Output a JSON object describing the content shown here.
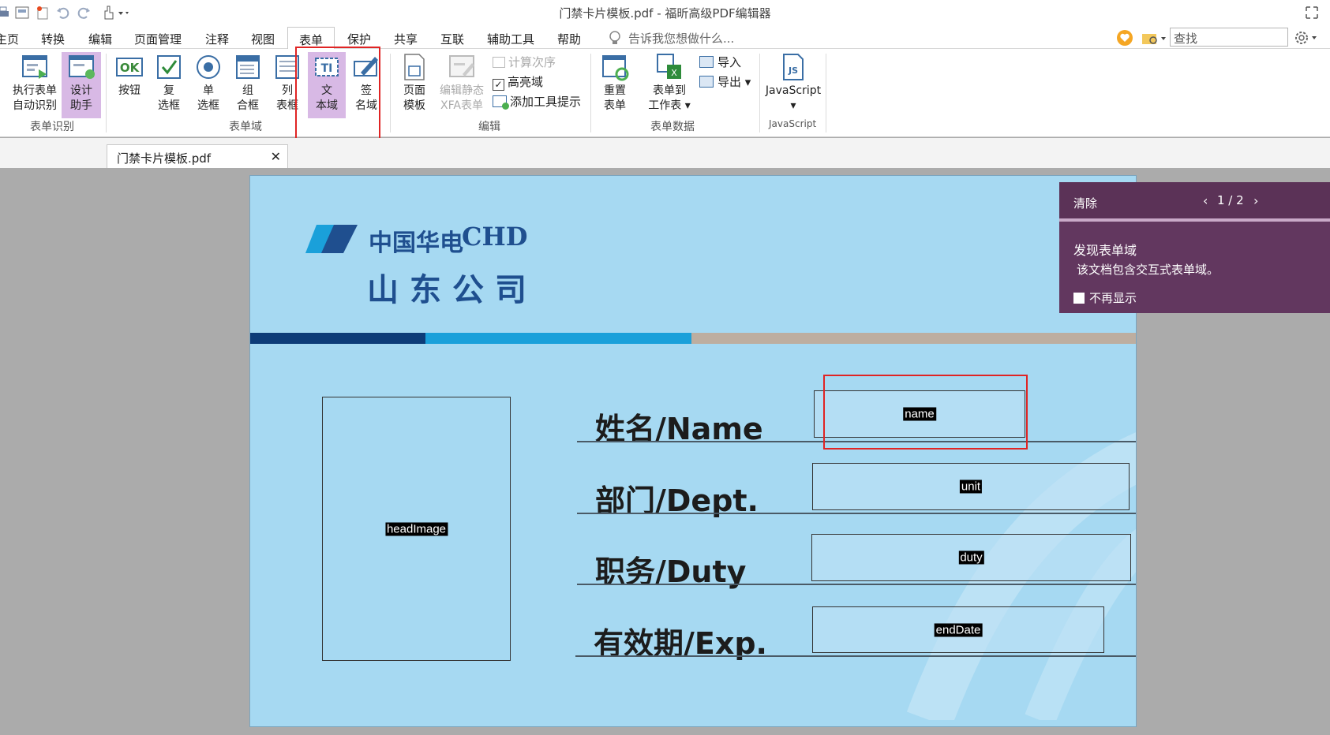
{
  "window": {
    "title": "门禁卡片模板.pdf - 福昕高级PDF编辑器"
  },
  "menu": {
    "items": [
      "主页",
      "转换",
      "编辑",
      "页面管理",
      "注释",
      "视图",
      "表单",
      "保护",
      "共享",
      "互联",
      "辅助工具",
      "帮助"
    ],
    "active": "表单",
    "tell_me": "告诉我您想做什么...",
    "search_placeholder": "查找"
  },
  "ribbon": {
    "groups": {
      "form_recognition": {
        "label": "表单识别",
        "run_recognition": [
          "执行表单",
          "自动识别"
        ],
        "design_assistant": [
          "设计",
          "助手"
        ]
      },
      "form_fields": {
        "label": "表单域",
        "push_button": "按钮",
        "checkbox": [
          "复",
          "选框"
        ],
        "radio": [
          "单",
          "选框"
        ],
        "combo": [
          "组",
          "合框"
        ],
        "list": [
          "列",
          "表框"
        ],
        "text_field": [
          "文",
          "本域"
        ],
        "signature": [
          "签",
          "名域"
        ]
      },
      "edit": {
        "label": "编辑",
        "page_templates": [
          "页面",
          "模板"
        ],
        "edit_static_xfa": [
          "编辑静态",
          "XFA表单"
        ],
        "calc_order": "计算次序",
        "highlight_fields": "高亮域",
        "add_tooltip": "添加工具提示"
      },
      "form_data": {
        "label": "表单数据",
        "reset": [
          "重置",
          "表单"
        ],
        "to_sheet": [
          "表单到",
          "工作表"
        ],
        "import": "导入",
        "export": "导出"
      },
      "javascript": {
        "label": "JavaScript",
        "javascript": "JavaScript"
      }
    }
  },
  "tabs": {
    "doc": "门禁卡片模板.pdf"
  },
  "document": {
    "logo_cn": "中国华电",
    "logo_en": "CHD",
    "company": "山东公司",
    "photo_field": "headImage",
    "fields": [
      {
        "label": "姓名/Name",
        "field": "name"
      },
      {
        "label": "部门/Dept.",
        "field": "unit"
      },
      {
        "label": "职务/Duty",
        "field": "duty"
      },
      {
        "label": "有效期/Exp.",
        "field": "endDate"
      }
    ]
  },
  "notification": {
    "clear": "清除",
    "pager": "1 / 2",
    "title": "发现表单域",
    "message": "该文档包含交互式表单域。",
    "dont_show": "不再显示"
  },
  "colors": {
    "page_bg": "#a6d9f2",
    "stripe_dark": "#0d3c78",
    "stripe_mid": "#1aa0da",
    "stripe_tan": "#bdaea0",
    "logo_blue": "#1f4f8f",
    "panel_purple": "#62375f",
    "highlight_red": "#e02424",
    "selected_purple": "#d8b9e5"
  }
}
